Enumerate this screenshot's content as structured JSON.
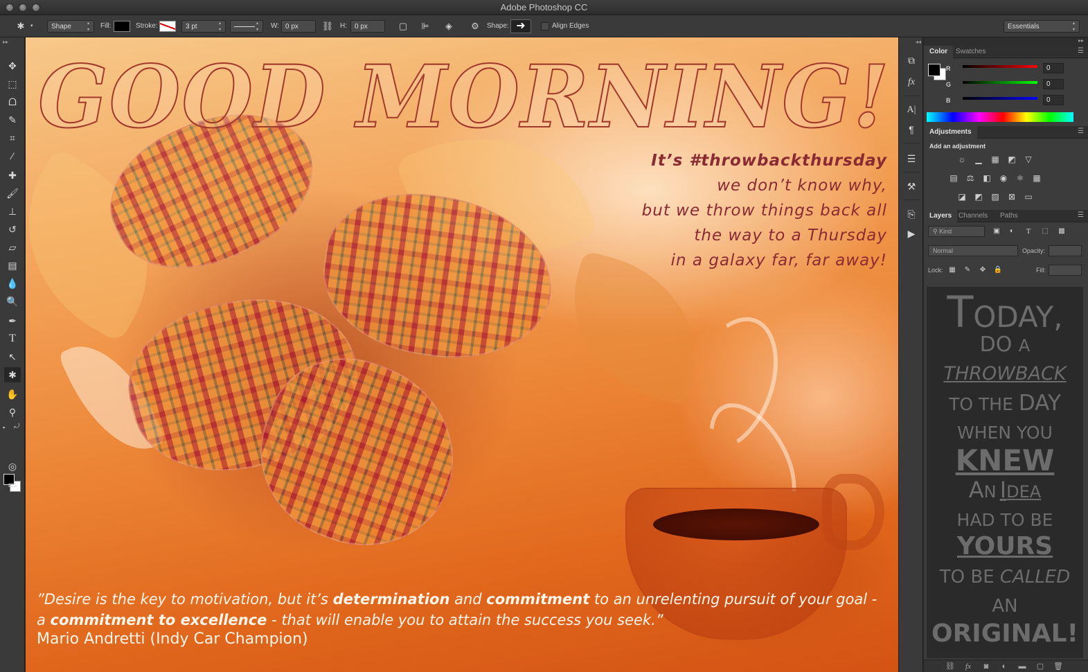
{
  "window": {
    "title": "Adobe Photoshop CC"
  },
  "options_bar": {
    "mode": "Shape",
    "fill_label": "Fill:",
    "stroke_label": "Stroke:",
    "stroke_width": "3 pt",
    "w_label": "W:",
    "w_value": "0 px",
    "h_label": "H:",
    "h_value": "0 px",
    "shape_label": "Shape:",
    "align_edges_label": "Align Edges",
    "workspace": "Essentials"
  },
  "tools": [
    "move-tool-icon",
    "marquee-tool-icon",
    "lasso-tool-icon",
    "quick-selection-icon",
    "crop-tool-icon",
    "eyedropper-icon",
    "healing-brush-icon",
    "brush-tool-icon",
    "clone-stamp-icon",
    "history-brush-icon",
    "eraser-icon",
    "gradient-tool-icon",
    "blur-tool-icon",
    "dodge-tool-icon",
    "pen-tool-icon",
    "type-tool-icon",
    "path-selection-icon",
    "custom-shape-icon",
    "hand-tool-icon",
    "zoom-tool-icon"
  ],
  "canvas": {
    "headline": "GOOD MORNING!",
    "tagline": [
      "It’s #throwbackthursday",
      "we don’t know why,",
      "but we throw things back all",
      "the way to a Thursday",
      "in a galaxy far, far away!"
    ],
    "quote": {
      "p1": "”Desire is the key to motivation, but it’s ",
      "b1": "determination",
      "p2": " and ",
      "b2": "commitment",
      "p3": " to an unrelenting pursuit of your goal - a ",
      "b3": "commitment to excellence",
      "p4": " - that will enable you to attain the success you seek.”"
    },
    "author": "Mario Andretti (Indy Car Champion)"
  },
  "color_panel": {
    "tabs": [
      "Color",
      "Swatches"
    ],
    "r_label": "R",
    "r_value": "0",
    "g_label": "G",
    "g_value": "0",
    "b_label": "B",
    "b_value": "0"
  },
  "adjustments_panel": {
    "tab": "Adjustments",
    "title": "Add an adjustment"
  },
  "layers_panel": {
    "tabs": [
      "Layers",
      "Channels",
      "Paths"
    ],
    "filter": "Kind",
    "blend_mode": "Normal",
    "opacity_label": "Opacity:",
    "lock_label": "Lock:",
    "fill_label": "Fill:"
  },
  "poster": {
    "l1a": "T",
    "l1b": "ODAY,",
    "l2a": "DO",
    "l2b": "A",
    "l3": "THROWBACK",
    "l4a": "TO",
    "l4b": "THE",
    "l4c": "DAY",
    "l5a": "WHEN",
    "l5b": "YOU",
    "l6": "KNEW",
    "l7a": "A",
    "l7b": "N",
    "l7c": "I",
    "l7d": "DEA",
    "l8a": "HAD",
    "l8b": "TO",
    "l8c": "BE",
    "l9": "YOURS",
    "l10a": "TO",
    "l10b": "BE",
    "l10c": "CALLED",
    "l11": "AN",
    "l12": "ORIGINAL!"
  },
  "colors": {
    "headline_stroke": "#a13a2a",
    "tagline": "#8a2a32",
    "poster_text": "#6c6c6c"
  }
}
